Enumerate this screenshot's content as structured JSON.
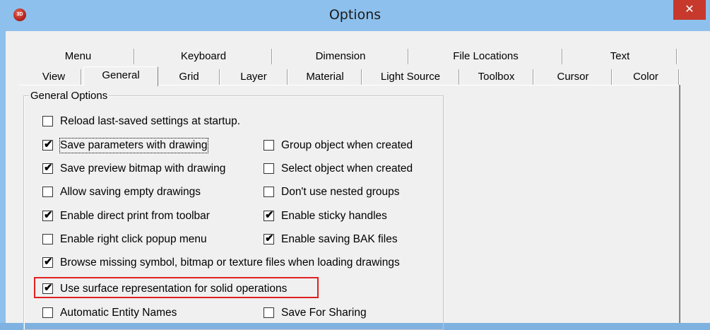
{
  "window": {
    "title": "Options",
    "icon_text": "3D",
    "close_glyph": "✕"
  },
  "tabs_row1": [
    {
      "label": "Menu"
    },
    {
      "label": "Keyboard"
    },
    {
      "label": "Dimension"
    },
    {
      "label": "File Locations"
    },
    {
      "label": "Text"
    }
  ],
  "tabs_row2": [
    {
      "label": "View"
    },
    {
      "label": "General"
    },
    {
      "label": "Grid"
    },
    {
      "label": "Layer"
    },
    {
      "label": "Material"
    },
    {
      "label": "Light Source"
    },
    {
      "label": "Toolbox"
    },
    {
      "label": "Cursor"
    },
    {
      "label": "Color"
    }
  ],
  "active_tab": "General",
  "group": {
    "label": "General Options"
  },
  "options": [
    {
      "label": "Reload last-saved settings at startup.",
      "checked": false
    },
    {
      "label": "Save parameters with drawing",
      "checked": true
    },
    {
      "label": "Group object when created",
      "checked": false
    },
    {
      "label": "Save preview bitmap with drawing",
      "checked": true
    },
    {
      "label": "Select object when created",
      "checked": false
    },
    {
      "label": "Allow saving empty drawings",
      "checked": false
    },
    {
      "label": "Don't use nested groups",
      "checked": false
    },
    {
      "label": "Enable direct print from toolbar",
      "checked": true
    },
    {
      "label": "Enable sticky handles",
      "checked": true
    },
    {
      "label": "Enable right click popup menu",
      "checked": false
    },
    {
      "label": "Enable saving BAK files",
      "checked": true
    },
    {
      "label": "Browse missing symbol, bitmap or texture files when loading drawings",
      "checked": true
    },
    {
      "label": "Use surface representation for solid operations",
      "checked": true
    },
    {
      "label": "Automatic Entity Names",
      "checked": false
    },
    {
      "label": "Save For Sharing",
      "checked": false
    }
  ],
  "colors": {
    "title_bar": "#8dc0ec",
    "close_button": "#c7392c",
    "highlight": "#e02020",
    "dialog_bg": "#f0f0f0"
  },
  "tick_glyph": "✔"
}
